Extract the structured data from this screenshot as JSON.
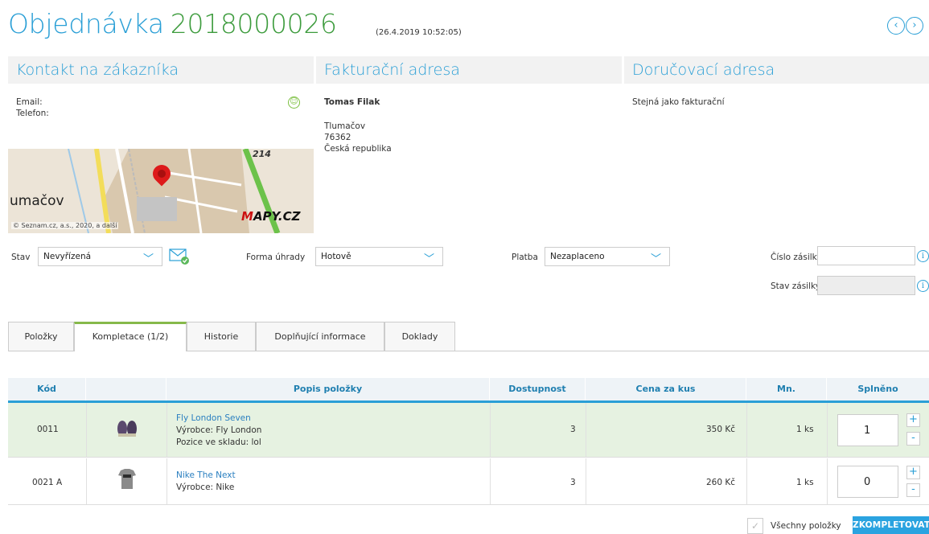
{
  "header": {
    "title": "Objednávka",
    "order_number": "2018000026",
    "date": "(26.4.2019 10:52:05)",
    "prev_icon": "chevron-left-icon",
    "next_icon": "chevron-right-icon"
  },
  "panels": {
    "contact": {
      "title": "Kontakt na zákazníka",
      "email_label": "Email:",
      "phone_label": "Telefon:",
      "map": {
        "town": "umačov",
        "copyright": "© Seznam.cz, a.s., 2020, a další",
        "logo_prefix": "M",
        "logo_rest": "APY.CZ",
        "road": "214"
      }
    },
    "billing": {
      "title": "Fakturační adresa",
      "name": "Tomas Filak",
      "city": "Tlumačov",
      "zip": "76362",
      "country": "Česká republika"
    },
    "delivery": {
      "title": "Doručovací adresa",
      "note": "Stejná jako fakturační"
    }
  },
  "form": {
    "state_label": "Stav",
    "state_value": "Nevyřízená",
    "payment_form_label": "Forma úhrady",
    "payment_form_value": "Hotově",
    "payment_label": "Platba",
    "payment_value": "Nezaplaceno",
    "parcel_number_label": "Číslo zásilky",
    "parcel_number_value": "",
    "parcel_state_label": "Stav zásilky",
    "parcel_state_value": ""
  },
  "tabs": [
    {
      "label": "Položky",
      "active": false
    },
    {
      "label": "Kompletace (1/2)",
      "active": true
    },
    {
      "label": "Historie",
      "active": false
    },
    {
      "label": "Doplňující informace",
      "active": false
    },
    {
      "label": "Doklady",
      "active": false
    }
  ],
  "table": {
    "columns": [
      "Kód",
      "",
      "Popis položky",
      "Dostupnost",
      "Cena za kus",
      "Mn.",
      "Splněno"
    ],
    "rows": [
      {
        "code": "0011",
        "name": "Fly London Seven",
        "line2": "Výrobce: Fly London",
        "line3": "Pozice ve skladu: lol",
        "availability": "3",
        "price": "350 Kč",
        "qty": "1 ks",
        "fulfilled": "1",
        "done": true
      },
      {
        "code": "0021 A",
        "name": "Nike The Next",
        "line2": "Výrobce: Nike",
        "line3": "",
        "availability": "3",
        "price": "260 Kč",
        "qty": "1 ks",
        "fulfilled": "0",
        "done": false
      }
    ]
  },
  "footer": {
    "all_items_label": "Všechny položky",
    "complete_button": "ZKOMPLETOVAT"
  },
  "colors": {
    "accent": "#2a9fd6",
    "order_number": "#3c9b3c",
    "done_row": "#e6f2e1",
    "button": "#2aa3e0"
  }
}
